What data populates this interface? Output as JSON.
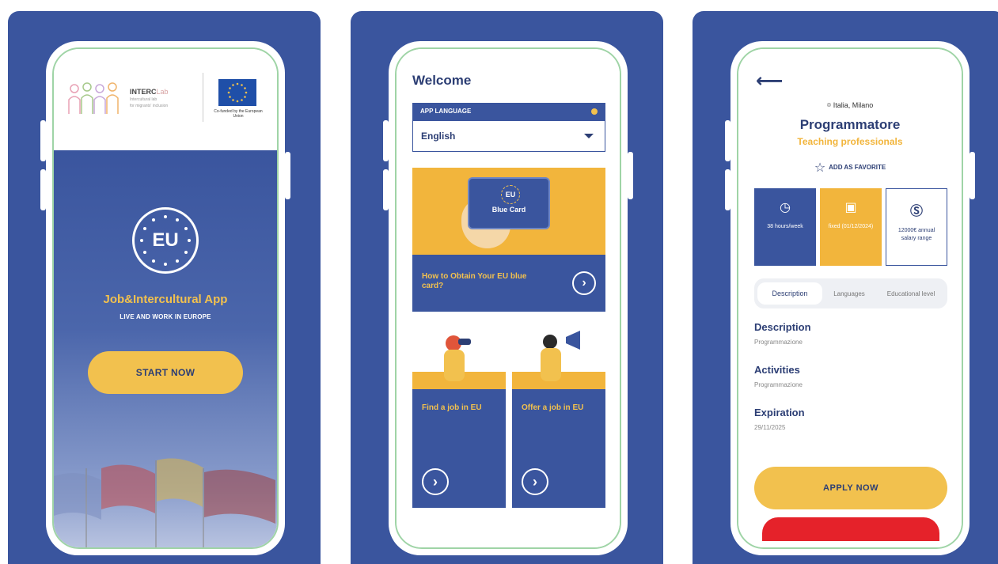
{
  "screen1": {
    "brand_name": "INTERC",
    "brand_suffix": "Lab",
    "brand_sub_line1": "Intercultural lab",
    "brand_sub_line2": "for migrants' inclusion",
    "eu_caption": "Co-funded by the European Union",
    "badge_text": "EU",
    "app_title": "Job&Intercultural App",
    "app_subtitle": "LIVE AND WORK IN EUROPE",
    "start_button": "START NOW"
  },
  "screen2": {
    "welcome": "Welcome",
    "language_label": "APP LANGUAGE",
    "language_value": "English",
    "bluecard_badge": "EU",
    "bluecard_label": "Blue Card",
    "bluecard_text": "How to Obtain Your EU blue card?",
    "find_job": "Find a job in EU",
    "offer_job": "Offer a job in EU"
  },
  "screen3": {
    "location": "Italia, Milano",
    "job_title": "Programmatore",
    "job_category": "Teaching professionals",
    "favorite_label": "ADD AS FAVORITE",
    "stats": [
      {
        "text": "38 hours/week"
      },
      {
        "text": "fixed (01/12/2024)"
      },
      {
        "text": "12000€ annual salary range"
      }
    ],
    "tabs": [
      "Description",
      "Languages",
      "Educational level"
    ],
    "description_title": "Description",
    "description_value": "Programmazione",
    "activities_title": "Activities",
    "activities_value": "Programmazione",
    "expiration_title": "Expiration",
    "expiration_value": "29/11/2025",
    "apply_button": "APPLY NOW"
  },
  "colors": {
    "primary_blue": "#3a559e",
    "accent_yellow": "#f2c14e",
    "navy_text": "#2c3e74",
    "danger_red": "#e5222a"
  }
}
